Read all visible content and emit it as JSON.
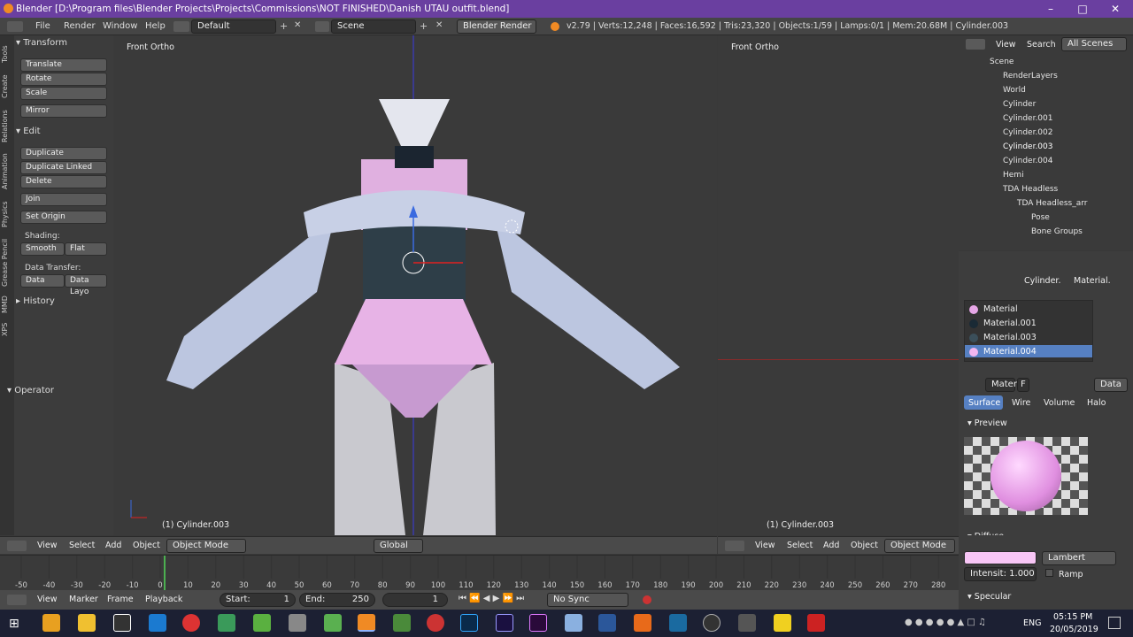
{
  "window": {
    "title": "Blender [D:\\Program files\\Blender Projects\\Projects\\Commissions\\NOT FINISHED\\Danish UTAU outfit.blend]"
  },
  "topbar": {
    "menus": [
      "File",
      "Render",
      "Window",
      "Help"
    ],
    "layout": "Default",
    "scene": "Scene",
    "engine": "Blender Render",
    "stats": "v2.79 | Verts:12,248 | Faces:16,592 | Tris:23,320 | Objects:1/59 | Lamps:0/1 | Mem:20.68M | Cylinder.003"
  },
  "toolshelf": {
    "tabs": [
      "Tools",
      "Create",
      "Relations",
      "Animation",
      "Physics",
      "Grease Pencil",
      "MMD",
      "XPS"
    ],
    "transform_header": "Transform",
    "transform": [
      "Translate",
      "Rotate",
      "Scale"
    ],
    "mirror": "Mirror",
    "edit_header": "Edit",
    "edit": [
      "Duplicate",
      "Duplicate Linked",
      "Delete"
    ],
    "join": "Join",
    "set_origin": "Set Origin",
    "shading_label": "Shading:",
    "smooth": "Smooth",
    "flat": "Flat",
    "data_transfer_label": "Data Transfer:",
    "data": "Data",
    "data_layout": "Data Layo",
    "history": "History",
    "operator": "Operator"
  },
  "viewport_left": {
    "label": "Front Ortho",
    "object": "(1) Cylinder.003"
  },
  "viewport_right": {
    "label": "Front Ortho",
    "object": "(1) Cylinder.003"
  },
  "viewhdr": {
    "view": "View",
    "select": "Select",
    "add": "Add",
    "object": "Object",
    "mode": "Object Mode",
    "orientation": "Global"
  },
  "outliner": {
    "menus": [
      "View",
      "Search",
      "All Scenes"
    ],
    "rows": [
      "Scene",
      "RenderLayers",
      "World",
      "Cylinder",
      "Cylinder.001",
      "Cylinder.002",
      "Cylinder.003",
      "Cylinder.004",
      "Hemi",
      "TDA Headless",
      "TDA Headless_arr",
      "Pose",
      "Bone Groups"
    ]
  },
  "props": {
    "breadcrumb_obj": "Cylinder.",
    "breadcrumb_mat": "Material.",
    "materials": [
      {
        "name": "Material",
        "color": "#e6a6e6"
      },
      {
        "name": "Material.001",
        "color": "#1a2a35"
      },
      {
        "name": "Material.003",
        "color": "#3b4f5a"
      },
      {
        "name": "Material.004",
        "color": "#f2b6f0"
      }
    ],
    "mat_field": "Materi",
    "f_label": "F",
    "data_label": "Data",
    "tabs": [
      "Surface",
      "Wire",
      "Volume",
      "Halo"
    ],
    "preview": "Preview",
    "diffuse": "Diffuse",
    "diffuse_color": "#f8c6f6",
    "shader": "Lambert",
    "intensity": "Intensit: 1.000",
    "ramp": "Ramp",
    "specular": "Specular"
  },
  "timeline": {
    "ticks": [
      "-50",
      "-40",
      "-30",
      "-20",
      "-10",
      "0",
      "10",
      "20",
      "30",
      "40",
      "50",
      "60",
      "70",
      "80",
      "90",
      "100",
      "110",
      "120",
      "130",
      "140",
      "150",
      "160",
      "170",
      "180",
      "190",
      "200",
      "210",
      "220",
      "230",
      "240",
      "250",
      "260",
      "270",
      "280"
    ],
    "current_frame": 1,
    "menus": [
      "View",
      "Marker",
      "Frame",
      "Playback"
    ],
    "start": "Start:",
    "start_val": "1",
    "end": "End:",
    "end_val": "250",
    "frame": "1",
    "sync": "No Sync"
  },
  "taskbar": {
    "lang": "ENG",
    "time": "05:15 PM",
    "date": "20/05/2019"
  }
}
